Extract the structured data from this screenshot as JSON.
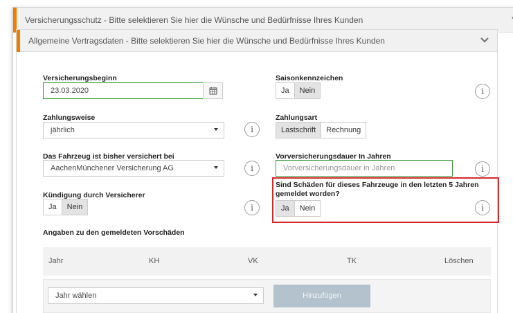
{
  "outer_panel": {
    "title": "Versicherungsschutz - Bitte selektieren Sie hier die Wünsche und Bedürfnisse Ihres Kunden",
    "chevron": "chevron-down-icon"
  },
  "inner_panel": {
    "title": "Allgemeine Vertragsdaten - Bitte selektieren Sie hier die Wünsche und Bedürfnisse Ihres Kunden",
    "chevron": "chevron-down-icon"
  },
  "fields": {
    "versicherungsbeginn": {
      "label": "Versicherungsbeginn",
      "value": "23.03.2020",
      "icon": "calendar-icon"
    },
    "saisonkennzeichen": {
      "label": "Saisonkennzeichen",
      "options": [
        "Ja",
        "Nein"
      ],
      "selected": "Nein"
    },
    "zahlungsweise": {
      "label": "Zahlungsweise",
      "value": "jährlich"
    },
    "zahlungsart": {
      "label": "Zahlungsart",
      "options": [
        "Lastschrift",
        "Rechnung"
      ],
      "selected": "Lastschrift"
    },
    "versichert_bei": {
      "label": "Das Fahrzeug ist bisher versichert bei",
      "value": "AachenMünchener Versicherung AG"
    },
    "vorversicherungsdauer": {
      "label": "Vorversicherungsdauer In Jahren",
      "placeholder": "Vorversicherungsdauer in Jahren"
    },
    "kuendigung": {
      "label": "Kündigung durch Versicherer",
      "options": [
        "Ja",
        "Nein"
      ],
      "selected": "Nein"
    },
    "schaeden": {
      "label": "Sind Schäden für dieses Fahrzeuge in den letzten 5 Jahren gemeldet worden?",
      "options": [
        "Ja",
        "Nein"
      ],
      "selected": "Ja"
    }
  },
  "info_icon_glyph": "i",
  "vorschaeden": {
    "heading": "Angaben zu den gemeldeten Vorschäden",
    "columns": [
      "Jahr",
      "KH",
      "VK",
      "TK",
      "Löschen"
    ],
    "year_select": "Jahr wählen",
    "add_button": "Hinzufügen"
  },
  "colors": {
    "accent": "#ef7d00",
    "valid_border": "#3a9b3a",
    "highlight": "#d62828",
    "disabled_button": "#b3c2cc"
  }
}
